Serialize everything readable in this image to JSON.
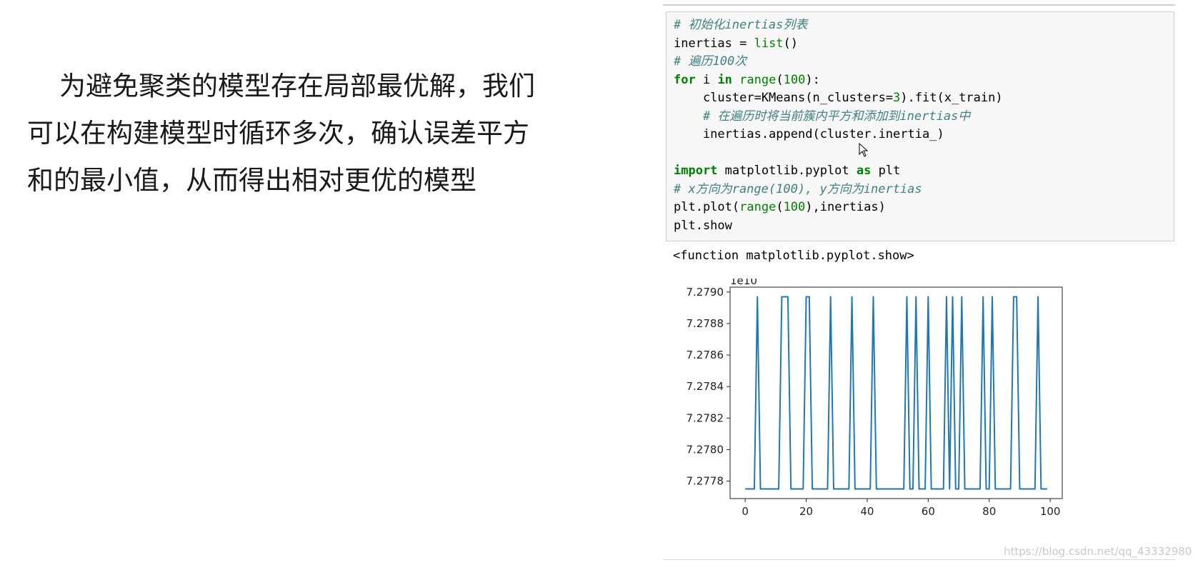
{
  "slide": {
    "lines": [
      "为避免聚类的模型存在局部最优解，我们",
      "可以在构建模型时循环多次，确认误差平方",
      "和的最小值，从而得出相对更优的模型"
    ]
  },
  "code": {
    "lines": [
      [
        {
          "t": "# 初始化inertias列表",
          "c": "cm"
        }
      ],
      [
        {
          "t": "inertias = ",
          "c": ""
        },
        {
          "t": "list",
          "c": "bi"
        },
        {
          "t": "()",
          "c": ""
        }
      ],
      [
        {
          "t": "# 遍历100次",
          "c": "cm"
        }
      ],
      [
        {
          "t": "for",
          "c": "kw"
        },
        {
          "t": " i ",
          "c": ""
        },
        {
          "t": "in",
          "c": "kw"
        },
        {
          "t": " ",
          "c": ""
        },
        {
          "t": "range",
          "c": "bi"
        },
        {
          "t": "(",
          "c": ""
        },
        {
          "t": "100",
          "c": "num"
        },
        {
          "t": "):",
          "c": ""
        }
      ],
      [
        {
          "t": "    cluster=KMeans(n_clusters=",
          "c": ""
        },
        {
          "t": "3",
          "c": "num"
        },
        {
          "t": ").fit(x_train)",
          "c": ""
        }
      ],
      [
        {
          "t": "    ",
          "c": ""
        },
        {
          "t": "# 在遍历时将当前簇内平方和添加到inertias中",
          "c": "cm"
        }
      ],
      [
        {
          "t": "    inertias.append(cluster.inertia_)",
          "c": ""
        }
      ],
      [
        {
          "t": "",
          "c": ""
        }
      ],
      [
        {
          "t": "import",
          "c": "kw"
        },
        {
          "t": " matplotlib.pyplot ",
          "c": ""
        },
        {
          "t": "as",
          "c": "kw"
        },
        {
          "t": " plt",
          "c": ""
        }
      ],
      [
        {
          "t": "# x方向为range(100), y方向为inertias",
          "c": "cm"
        }
      ],
      [
        {
          "t": "plt.plot(",
          "c": ""
        },
        {
          "t": "range",
          "c": "bi"
        },
        {
          "t": "(",
          "c": ""
        },
        {
          "t": "100",
          "c": "num"
        },
        {
          "t": "),inertias)",
          "c": ""
        }
      ],
      [
        {
          "t": "plt.show",
          "c": ""
        }
      ]
    ]
  },
  "output": {
    "text": "<function matplotlib.pyplot.show>"
  },
  "chart_data": {
    "type": "line",
    "x": [
      0,
      1,
      2,
      3,
      4,
      5,
      6,
      7,
      8,
      9,
      10,
      11,
      12,
      13,
      14,
      15,
      16,
      17,
      18,
      19,
      20,
      21,
      22,
      23,
      24,
      25,
      26,
      27,
      28,
      29,
      30,
      31,
      32,
      33,
      34,
      35,
      36,
      37,
      38,
      39,
      40,
      41,
      42,
      43,
      44,
      45,
      46,
      47,
      48,
      49,
      50,
      51,
      52,
      53,
      54,
      55,
      56,
      57,
      58,
      59,
      60,
      61,
      62,
      63,
      64,
      65,
      66,
      67,
      68,
      69,
      70,
      71,
      72,
      73,
      74,
      75,
      76,
      77,
      78,
      79,
      80,
      81,
      82,
      83,
      84,
      85,
      86,
      87,
      88,
      89,
      90,
      91,
      92,
      93,
      94,
      95,
      96,
      97,
      98,
      99
    ],
    "series": [
      {
        "values": [
          7.27775,
          7.27775,
          7.27775,
          7.27775,
          7.27897,
          7.27775,
          7.27775,
          7.27775,
          7.27775,
          7.27775,
          7.27775,
          7.27775,
          7.27897,
          7.27897,
          7.27897,
          7.27775,
          7.27775,
          7.27775,
          7.27775,
          7.27775,
          7.27897,
          7.27897,
          7.27775,
          7.27775,
          7.27775,
          7.27775,
          7.27775,
          7.27775,
          7.27897,
          7.27775,
          7.27775,
          7.27775,
          7.27775,
          7.27775,
          7.27775,
          7.27897,
          7.27775,
          7.27775,
          7.27775,
          7.27775,
          7.27775,
          7.27775,
          7.27897,
          7.27775,
          7.27775,
          7.27775,
          7.27775,
          7.27775,
          7.27775,
          7.27775,
          7.27775,
          7.27775,
          7.27775,
          7.27897,
          7.27775,
          7.27775,
          7.27897,
          7.27775,
          7.27775,
          7.27775,
          7.27897,
          7.27775,
          7.27775,
          7.27775,
          7.27775,
          7.27775,
          7.27897,
          7.27775,
          7.27897,
          7.27775,
          7.27775,
          7.27897,
          7.27775,
          7.27775,
          7.27775,
          7.27775,
          7.27775,
          7.27775,
          7.27897,
          7.27775,
          7.27775,
          7.27897,
          7.27775,
          7.27775,
          7.27775,
          7.27775,
          7.27775,
          7.27775,
          7.27897,
          7.27897,
          7.27775,
          7.27775,
          7.27775,
          7.27775,
          7.27775,
          7.27775,
          7.27897,
          7.27775,
          7.27775,
          7.27775
        ]
      }
    ],
    "x_ticks": [
      0,
      20,
      40,
      60,
      80,
      100
    ],
    "y_ticks": [
      7.2778,
      7.278,
      7.2782,
      7.2784,
      7.2786,
      7.2788,
      7.279
    ],
    "y_tick_labels": [
      "7.2778",
      "7.2780",
      "7.2782",
      "7.2784",
      "7.2786",
      "7.2788",
      "7.2790"
    ],
    "xlim": [
      -4.95,
      103.95
    ],
    "ylim": [
      7.277689,
      7.279031
    ],
    "offset_label": "1e10",
    "line_color": "#1f77b4",
    "grid": false,
    "title": "",
    "xlabel": "",
    "ylabel": ""
  },
  "watermark": "https://blog.csdn.net/qq_43332980"
}
